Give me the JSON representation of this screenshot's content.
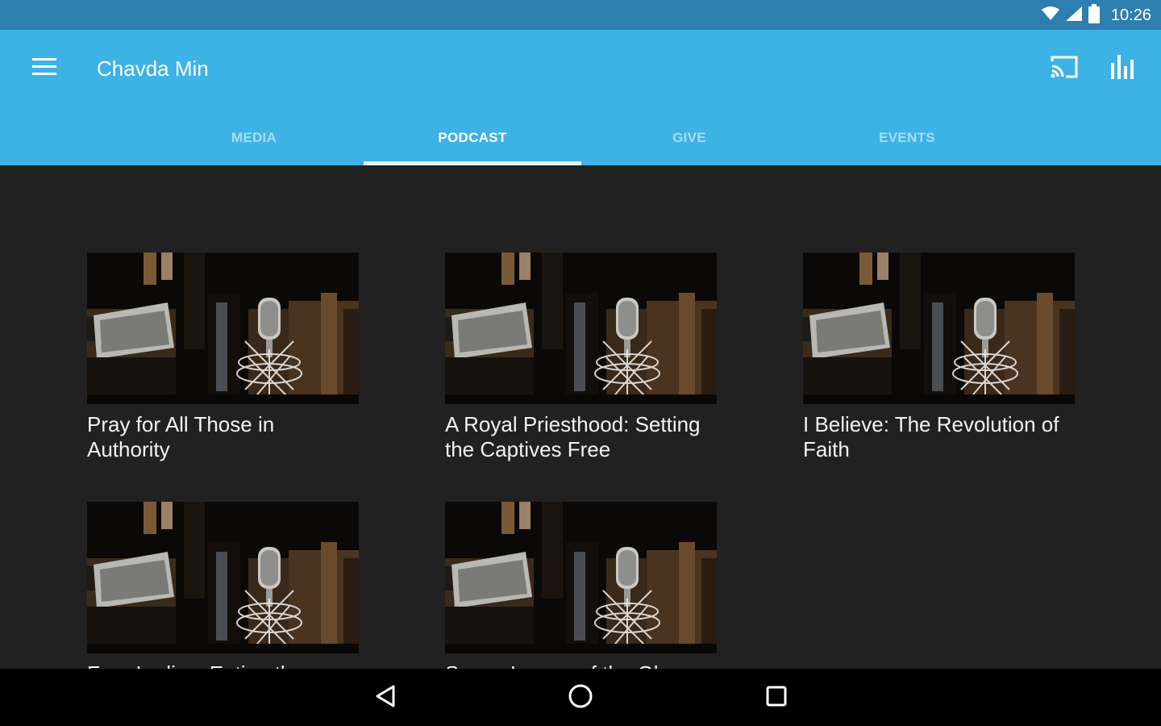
{
  "status_bar": {
    "time": "10:26"
  },
  "app_bar": {
    "title": "Chavda Min"
  },
  "tabs": [
    {
      "label": "MEDIA",
      "active": false
    },
    {
      "label": "PODCAST",
      "active": true
    },
    {
      "label": "GIVE",
      "active": false
    },
    {
      "label": "EVENTS",
      "active": false
    }
  ],
  "podcasts": [
    {
      "title": "Pray for All Those in Authority"
    },
    {
      "title": "A Royal Priesthood: Setting the Captives Free"
    },
    {
      "title": "I Believe: The Revolution of Faith"
    },
    {
      "title": "Four Ladies: Eating the…"
    },
    {
      "title": "Seven Lamps of the Glory of…"
    }
  ],
  "colors": {
    "status_bar": "#2e7eb0",
    "app_bar": "#3db2e5",
    "background": "#212121"
  },
  "icons": [
    "menu-icon",
    "cast-icon",
    "equalizer-icon",
    "wifi-icon",
    "signal-icon",
    "battery-icon",
    "back-icon",
    "home-icon",
    "recents-icon",
    "microphone-image"
  ]
}
